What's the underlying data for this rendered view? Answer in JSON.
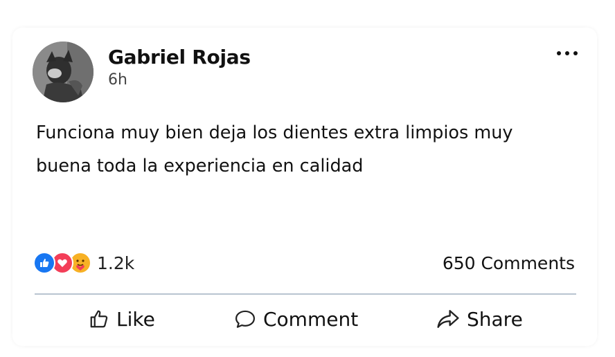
{
  "post": {
    "author": "Gabriel Rojas",
    "time": "6h",
    "text": "Funciona muy bien deja los dientes extra limpios muy buena toda la experiencia en calidad"
  },
  "reactions": {
    "icons": [
      "like-icon",
      "love-icon",
      "care-icon"
    ],
    "count": "1.2k",
    "colors": {
      "like": "#1877f2",
      "love": "#f33e58",
      "care": "#f7b125"
    }
  },
  "comments_count": "650 Comments",
  "actions": {
    "like": "Like",
    "comment": "Comment",
    "share": "Share"
  }
}
